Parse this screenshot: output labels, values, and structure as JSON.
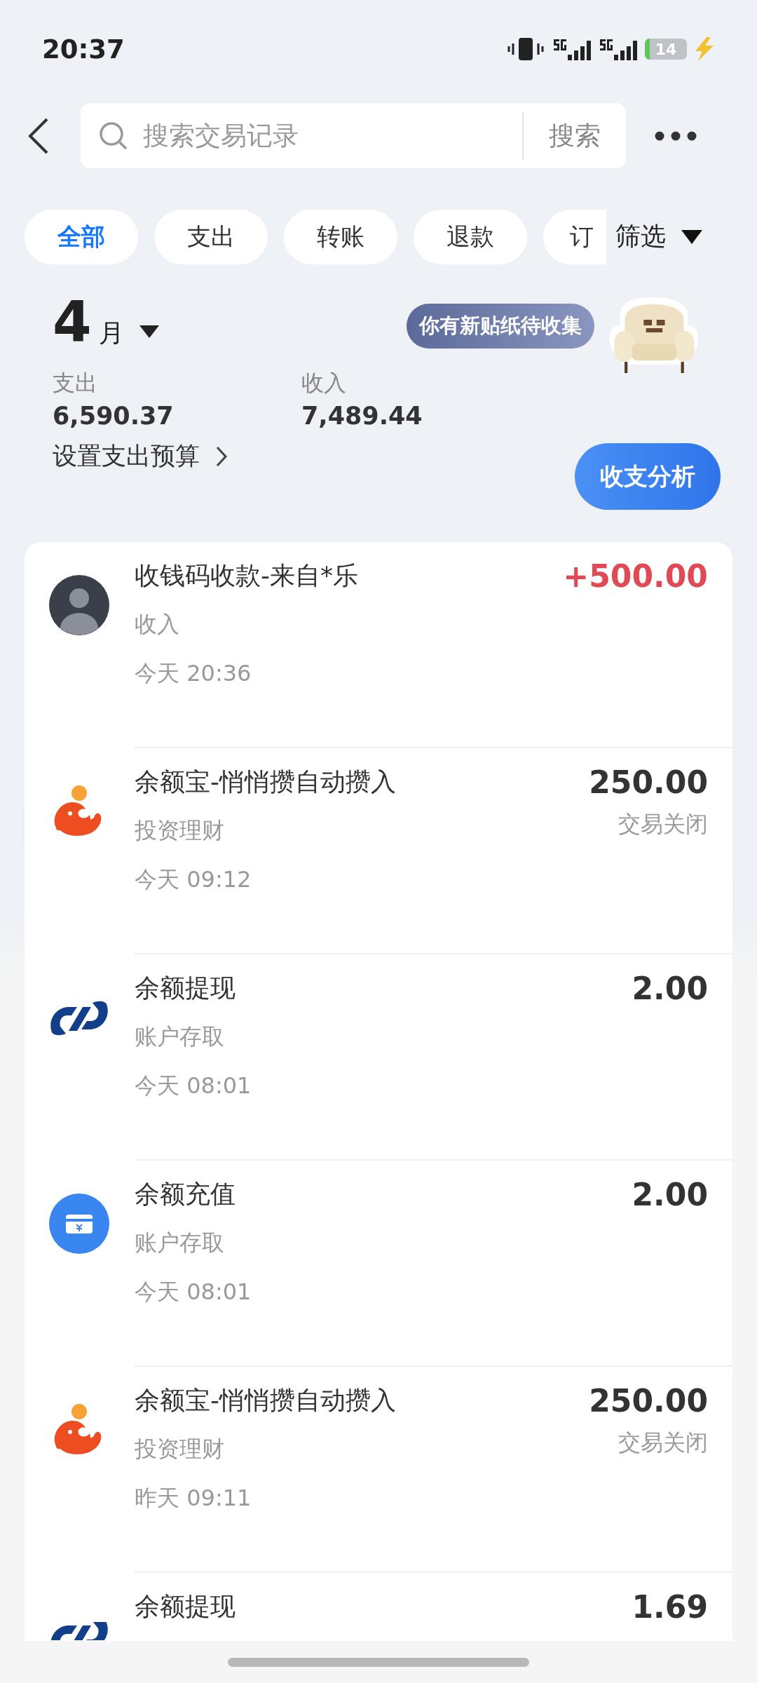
{
  "status_bar": {
    "time": "20:37",
    "battery": "14"
  },
  "search": {
    "placeholder": "搜索交易记录",
    "button": "搜索"
  },
  "filters": [
    {
      "label": "全部",
      "selected": true
    },
    {
      "label": "支出",
      "selected": false
    },
    {
      "label": "转账",
      "selected": false
    },
    {
      "label": "退款",
      "selected": false
    },
    {
      "label": "订",
      "selected": false
    }
  ],
  "filter_button": "筛选",
  "month": {
    "number": "4",
    "unit": "月"
  },
  "summary": [
    {
      "label": "支出",
      "amount": "6,590.37"
    },
    {
      "label": "收入",
      "amount": "7,489.44"
    }
  ],
  "budget_link": "设置支出预算",
  "sticker_bubble": "你有新贴纸待收集",
  "analysis_button": "收支分析",
  "transactions": [
    {
      "kind": "avatar",
      "title": "收钱码收款-来自*乐",
      "category": "收入",
      "time": "今天 20:36",
      "amount": "+500.00",
      "income": true
    },
    {
      "kind": "yuebao",
      "title": "余额宝-悄悄攒自动攒入",
      "category": "投资理财",
      "time": "今天 09:12",
      "amount": "250.00",
      "income": false,
      "status": "交易关闭"
    },
    {
      "kind": "bank",
      "title": "余额提现",
      "category": "账户存取",
      "time": "今天 08:01",
      "amount": "2.00",
      "income": false
    },
    {
      "kind": "recharge",
      "title": "余额充值",
      "category": "账户存取",
      "time": "今天 08:01",
      "amount": "2.00",
      "income": false
    },
    {
      "kind": "yuebao",
      "title": "余额宝-悄悄攒自动攒入",
      "category": "投资理财",
      "time": "昨天 09:11",
      "amount": "250.00",
      "income": false,
      "status": "交易关闭"
    },
    {
      "kind": "bank",
      "title": "余额提现",
      "amount": "1.69",
      "income": false
    }
  ]
}
